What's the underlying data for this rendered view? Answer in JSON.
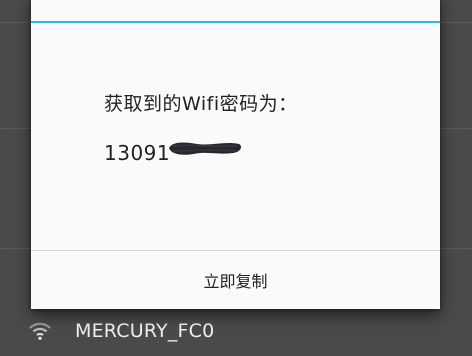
{
  "dialog": {
    "message": "获取到的Wifi密码为：",
    "password_visible": "13091",
    "button_label": "立即复制",
    "accent_color": "#33b5e5"
  },
  "background_list": {
    "visible_item": {
      "ssid": "MERCURY_FC0",
      "icon": "wifi-icon"
    }
  }
}
